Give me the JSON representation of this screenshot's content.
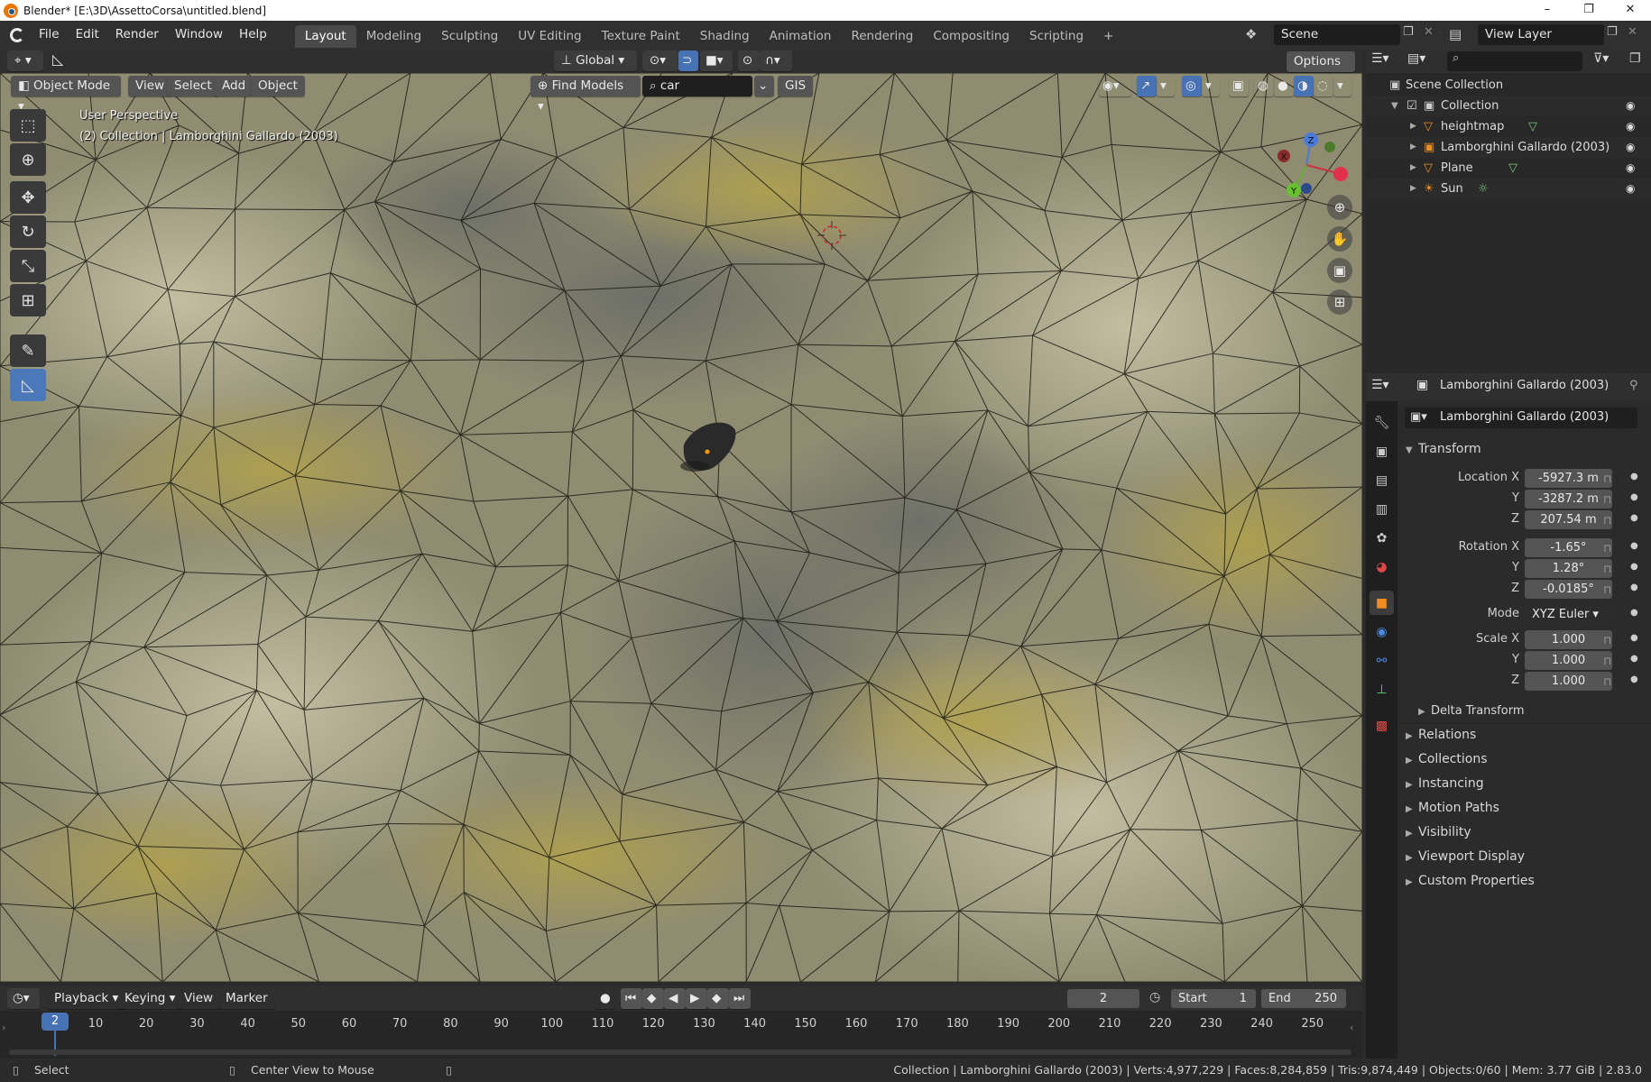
{
  "window": {
    "title": "Blender* [E:\\3D\\AssettoCorsa\\untitled.blend]",
    "minimize": "–",
    "maximize": "❐",
    "close": "✕"
  },
  "menu": [
    "File",
    "Edit",
    "Render",
    "Window",
    "Help"
  ],
  "workspaces": [
    "Layout",
    "Modeling",
    "Sculpting",
    "UV Editing",
    "Texture Paint",
    "Shading",
    "Animation",
    "Rendering",
    "Compositing",
    "Scripting"
  ],
  "workspace_add": "+",
  "scene": {
    "name": "Scene",
    "view_layer": "View Layer"
  },
  "viewport_header": {
    "orientation": "Global",
    "options": "Options",
    "mode": "Object Mode",
    "view": "View",
    "select": "Select",
    "add": "Add",
    "object": "Object",
    "find_models": "Find Models",
    "search_value": "car",
    "gis": "GIS"
  },
  "viewport": {
    "perspective": "User Perspective",
    "collection_info": "(2) Collection | Lamborghini Gallardo (2003)",
    "gizmo": {
      "x": "X",
      "y": "Y",
      "z": "Z"
    }
  },
  "outliner": {
    "root": "Scene Collection",
    "collection": "Collection",
    "items": [
      "heightmap",
      "Lamborghini Gallardo (2003)",
      "Plane",
      "Sun"
    ]
  },
  "properties": {
    "header_object": "Lamborghini Gallardo (2003)",
    "object_name": "Lamborghini Gallardo (2003)",
    "transform_label": "Transform",
    "location": {
      "label_x": "Location X",
      "x": "-5927.3 m",
      "y": "-3287.2 m",
      "z": "207.54 m"
    },
    "rotation": {
      "label_x": "Rotation X",
      "x": "-1.65°",
      "y": "1.28°",
      "z": "-0.0185°"
    },
    "mode_label": "Mode",
    "mode_value": "XYZ Euler",
    "scale": {
      "label_x": "Scale X",
      "x": "1.000",
      "y": "1.000",
      "z": "1.000"
    },
    "axis_y": "Y",
    "axis_z": "Z",
    "delta_transform": "Delta Transform",
    "panels": [
      "Relations",
      "Collections",
      "Instancing",
      "Motion Paths",
      "Visibility",
      "Viewport Display",
      "Custom Properties"
    ]
  },
  "timeline": {
    "playback": "Playback",
    "keying": "Keying",
    "view": "View",
    "marker": "Marker",
    "current_frame": "2",
    "start_label": "Start",
    "start": "1",
    "end_label": "End",
    "end": "250",
    "ticks": [
      "10",
      "20",
      "30",
      "40",
      "50",
      "60",
      "70",
      "80",
      "90",
      "100",
      "110",
      "120",
      "130",
      "140",
      "150",
      "160",
      "170",
      "180",
      "190",
      "200",
      "210",
      "220",
      "230",
      "240",
      "250"
    ]
  },
  "statusbar": {
    "select": "Select",
    "center_view": "Center View to Mouse",
    "info": "Collection | Lamborghini Gallardo (2003) | Verts:4,977,229 | Faces:8,284,859 | Tris:9,874,449 | Objects:0/60 | Mem: 3.77 GiB | 2.83.0"
  }
}
